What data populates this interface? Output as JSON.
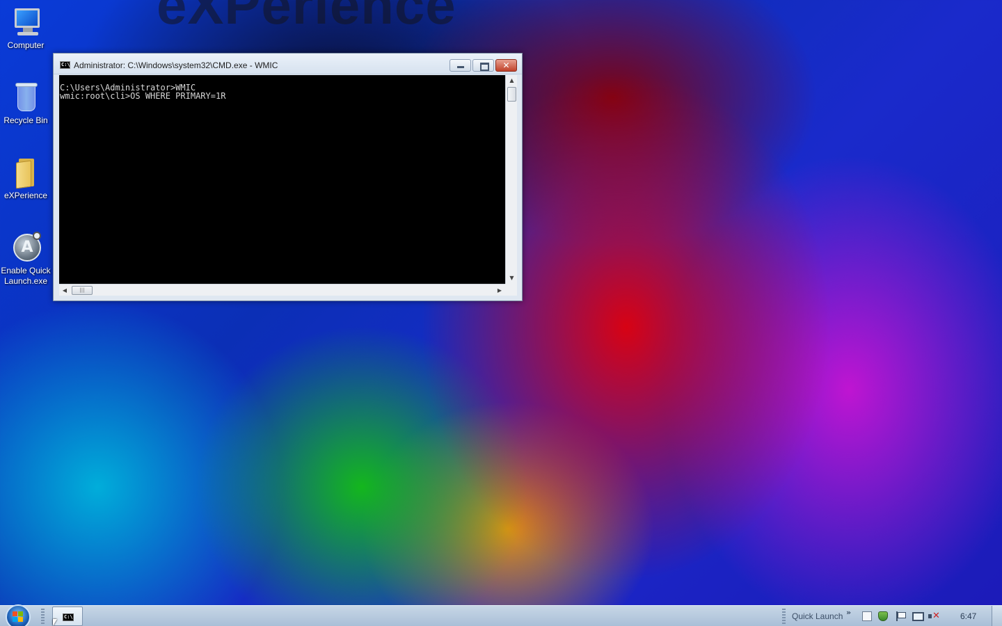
{
  "wallpaper": {
    "watermark_text": "eXPerience"
  },
  "desktop": {
    "icons": [
      {
        "label": "Computer",
        "icon": "computer-icon"
      },
      {
        "label": "Recycle Bin",
        "icon": "recycle-bin-icon"
      },
      {
        "label": "eXPerience",
        "icon": "folder-icon"
      },
      {
        "label": "Enable Quick Launch.exe",
        "icon": "quick-launch-app-icon"
      }
    ]
  },
  "window": {
    "title": "Administrator: C:\\Windows\\system32\\CMD.exe - WMIC",
    "icon_text": "C:\\",
    "console_lines": [
      "C:\\Users\\Administrator>WMIC",
      "wmic:root\\cli>OS WHERE PRIMARY=1R"
    ],
    "hscroll_thumb": "|||",
    "buttons": {
      "minimize": "minimize-icon",
      "maximize": "maximize-icon",
      "close": "close-icon"
    }
  },
  "taskbar": {
    "quick_launch_label": "Quick Launch",
    "quick_launch_chevron": "»",
    "task_icon_text": "C:\\",
    "clock": "6:47",
    "tray_icons": [
      "document-icon",
      "security-shield-icon",
      "action-center-flag-icon",
      "network-icon",
      "volume-muted-icon"
    ],
    "colors": {
      "close_button": "#c0412a",
      "taskbar": "#b8cbe0"
    }
  }
}
